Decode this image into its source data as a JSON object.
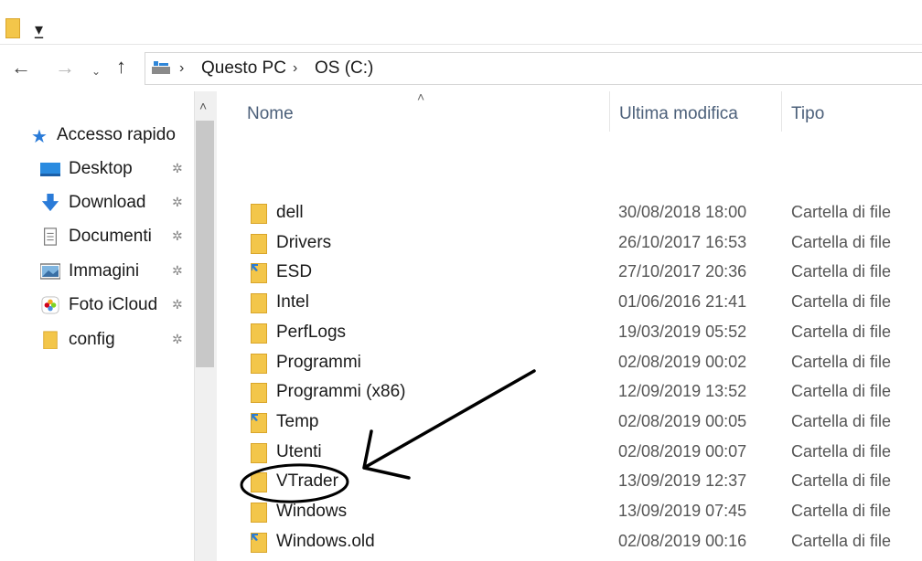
{
  "toolbar": {
    "quick_access_glyph": "▾̲"
  },
  "nav": {
    "back": "←",
    "forward": "→",
    "recent": "⌄",
    "up": "↑"
  },
  "address": {
    "sep": "›",
    "crumbs": [
      "Questo PC",
      "OS (C:)"
    ]
  },
  "sidebar": {
    "quick_access": "Accesso rapido",
    "scroll_up": "˄",
    "pin_glyph": "✲",
    "items": [
      {
        "label": "Desktop",
        "icon": "desktop-icon"
      },
      {
        "label": "Download",
        "icon": "download-icon"
      },
      {
        "label": "Documenti",
        "icon": "documents-icon"
      },
      {
        "label": "Immagini",
        "icon": "pictures-icon"
      },
      {
        "label": "Foto iCloud",
        "icon": "icloud-photos-icon"
      },
      {
        "label": "config",
        "icon": "folder-icon"
      }
    ]
  },
  "columns": {
    "sort_caret": "˄",
    "name": "Nome",
    "modified": "Ultima modifica",
    "type": "Tipo"
  },
  "files": [
    {
      "name": "dell",
      "modified": "30/08/2018 18:00",
      "type": "Cartella di file",
      "icon": "folder-icon"
    },
    {
      "name": "Drivers",
      "modified": "26/10/2017 16:53",
      "type": "Cartella di file",
      "icon": "folder-icon"
    },
    {
      "name": "ESD",
      "modified": "27/10/2017 20:36",
      "type": "Cartella di file",
      "icon": "folder-shortcut-icon"
    },
    {
      "name": "Intel",
      "modified": "01/06/2016 21:41",
      "type": "Cartella di file",
      "icon": "folder-icon"
    },
    {
      "name": "PerfLogs",
      "modified": "19/03/2019 05:52",
      "type": "Cartella di file",
      "icon": "folder-icon"
    },
    {
      "name": "Programmi",
      "modified": "02/08/2019 00:02",
      "type": "Cartella di file",
      "icon": "folder-icon"
    },
    {
      "name": "Programmi (x86)",
      "modified": "12/09/2019 13:52",
      "type": "Cartella di file",
      "icon": "folder-icon"
    },
    {
      "name": "Temp",
      "modified": "02/08/2019 00:05",
      "type": "Cartella di file",
      "icon": "folder-shortcut-icon"
    },
    {
      "name": "Utenti",
      "modified": "02/08/2019 00:07",
      "type": "Cartella di file",
      "icon": "folder-icon"
    },
    {
      "name": "VTrader",
      "modified": "13/09/2019 12:37",
      "type": "Cartella di file",
      "icon": "folder-icon"
    },
    {
      "name": "Windows",
      "modified": "13/09/2019 07:45",
      "type": "Cartella di file",
      "icon": "folder-icon"
    },
    {
      "name": "Windows.old",
      "modified": "02/08/2019 00:16",
      "type": "Cartella di file",
      "icon": "folder-shortcut-icon"
    }
  ],
  "colors": {
    "folder": "#f3c64a",
    "folder_edge": "#d9a52b",
    "shortcut": "#2b7cd3",
    "header_text": "#4c607a"
  }
}
